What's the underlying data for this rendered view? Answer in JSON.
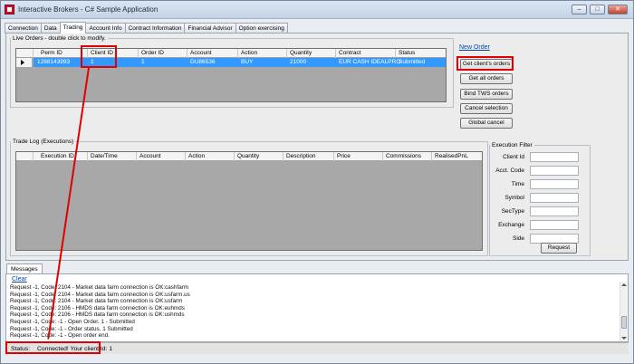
{
  "window": {
    "title": "Interactive Brokers - C# Sample Application"
  },
  "tabs": [
    {
      "label": "Connection"
    },
    {
      "label": "Data"
    },
    {
      "label": "Trading"
    },
    {
      "label": "Account Info"
    },
    {
      "label": "Contract Information"
    },
    {
      "label": "Financial Advisor"
    },
    {
      "label": "Option exercising"
    }
  ],
  "live_orders": {
    "legend": "Live Orders - double click to modify.",
    "columns": [
      "Perm ID",
      "Client ID",
      "Order ID",
      "Account",
      "Action",
      "Quantity",
      "Contract",
      "Status"
    ],
    "rows": [
      {
        "perm_id": "1288143993",
        "client_id": "1",
        "order_id": "1",
        "account": "DU86536",
        "action": "BUY",
        "quantity": "21000",
        "contract": "EUR CASH IDEALPRO",
        "status": "Submitted"
      }
    ]
  },
  "order_actions": {
    "new_order": "New Order",
    "get_client_orders": "Get client's orders",
    "get_all_orders": "Get all orders",
    "bind_tws_orders": "Bind TWS orders",
    "cancel_selection": "Cancel selection",
    "global_cancel": "Global cancel"
  },
  "trade_log": {
    "legend": "Trade Log (Executions)",
    "columns": [
      "Execution ID",
      "Date/Time",
      "Account",
      "Action",
      "Quantity",
      "Description",
      "Price",
      "Commissions",
      "RealisedPnL"
    ]
  },
  "execution_filter": {
    "legend": "Execution Filter",
    "fields": [
      {
        "label": "Client Id",
        "value": ""
      },
      {
        "label": "Acct. Code",
        "value": ""
      },
      {
        "label": "Time",
        "value": ""
      },
      {
        "label": "Symbol",
        "value": ""
      },
      {
        "label": "SecType",
        "value": ""
      },
      {
        "label": "Exchange",
        "value": ""
      },
      {
        "label": "Side",
        "value": ""
      }
    ],
    "request_button": "Request"
  },
  "messages": {
    "tab_label": "Messages",
    "clear_link": "Clear",
    "lines": [
      "Request -1, Code: 2104 - Market data farm connection is OK:cashfarm",
      "Request -1, Code: 2104 - Market data farm connection is OK:usfarm.us",
      "Request -1, Code: 2104 - Market data farm connection is OK:usfarm",
      "Request -1, Code: 2106 - HMDS data farm connection is OK:euhmds",
      "Request -1, Code: 2106 - HMDS data farm connection is OK:ushmds",
      "Request -1, Code: -1 - Open Order. 1 - Submitted",
      "Request -1, Code: -1 - Order status. 1 Submitted",
      "Request -1, Code: -1 - Open order end."
    ]
  },
  "status": {
    "label": "Status:",
    "text": "Connected! Your client Id: 1"
  },
  "colors": {
    "selection": "#3399ff",
    "highlight": "#e00000",
    "link": "#0645ad"
  }
}
